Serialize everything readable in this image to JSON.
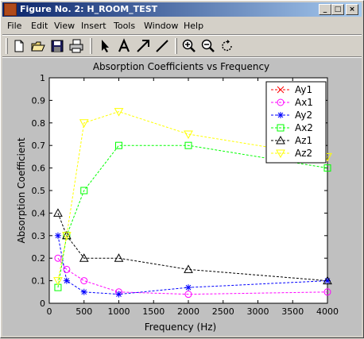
{
  "window": {
    "title": "Figure No. 2: H_ROOM_TEST",
    "min_label": "_",
    "max_label": "□",
    "close_label": "×"
  },
  "menu": [
    "File",
    "Edit",
    "View",
    "Insert",
    "Tools",
    "Window",
    "Help"
  ],
  "toolbar": [
    "new-file-icon",
    "open-folder-icon",
    "save-icon",
    "print-icon",
    "select-arrow-icon",
    "insert-text-icon",
    "insert-arrow-icon",
    "insert-line-icon",
    "zoom-in-icon",
    "zoom-out-icon",
    "rotate-icon"
  ],
  "chart_data": {
    "type": "line",
    "title": "Absorption Coefficients vs Frequency",
    "xlabel": "Frequency (Hz)",
    "ylabel": "Absorption Coefficient",
    "xlim": [
      0,
      4000
    ],
    "ylim": [
      0,
      1
    ],
    "xticks": [
      "0",
      "500",
      "1000",
      "1500",
      "2000",
      "2500",
      "3000",
      "3500",
      "4000"
    ],
    "yticks": [
      "0",
      "0.1",
      "0.2",
      "0.3",
      "0.4",
      "0.5",
      "0.6",
      "0.7",
      "0.8",
      "0.9",
      "1"
    ],
    "grid": false,
    "legend_position": "top-right",
    "x": [
      125,
      250,
      500,
      1000,
      2000,
      4000
    ],
    "series": [
      {
        "name": "Ay1",
        "color": "#ff0000",
        "marker": "x",
        "values": [
          null,
          null,
          null,
          null,
          null,
          null
        ]
      },
      {
        "name": "Ax1",
        "color": "#ff00ff",
        "marker": "o",
        "values": [
          0.2,
          0.15,
          0.1,
          0.05,
          0.04,
          0.05
        ]
      },
      {
        "name": "Ay2",
        "color": "#0000ff",
        "marker": "*",
        "values": [
          0.3,
          0.1,
          0.05,
          0.04,
          0.07,
          0.1
        ]
      },
      {
        "name": "Ax2",
        "color": "#00ff00",
        "marker": "s",
        "values": [
          0.07,
          0.3,
          0.5,
          0.7,
          0.7,
          0.6
        ]
      },
      {
        "name": "Az1",
        "color": "#000000",
        "marker": "^",
        "values": [
          0.4,
          0.3,
          0.2,
          0.2,
          0.15,
          0.1
        ]
      },
      {
        "name": "Az2",
        "color": "#ffff00",
        "marker": "v",
        "values": [
          0.1,
          0.3,
          0.8,
          0.85,
          0.75,
          0.65
        ]
      }
    ]
  }
}
